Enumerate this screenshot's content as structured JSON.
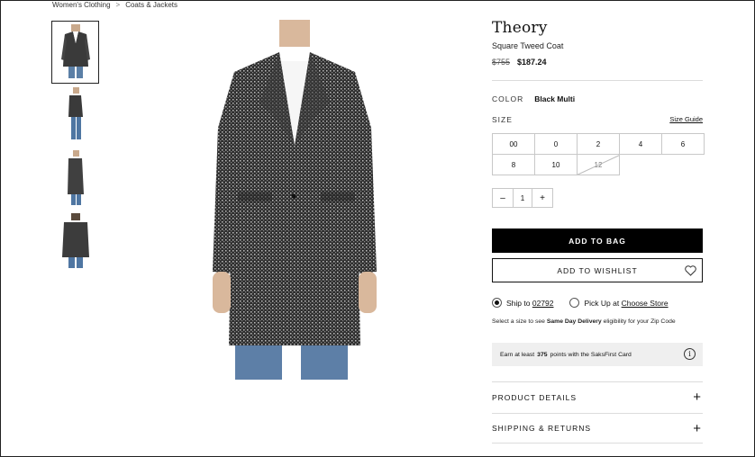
{
  "breadcrumb": {
    "items": [
      "Women's Clothing",
      "Coats & Jackets"
    ],
    "separator": ">"
  },
  "product": {
    "brand": "Theory",
    "name": "Square Tweed Coat",
    "price_original": "$755",
    "price_sale": "$187.24"
  },
  "color": {
    "label": "COLOR",
    "value": "Black Multi"
  },
  "size": {
    "label": "SIZE",
    "guide_label": "Size Guide",
    "options": [
      {
        "value": "00",
        "available": true
      },
      {
        "value": "0",
        "available": true
      },
      {
        "value": "2",
        "available": true
      },
      {
        "value": "4",
        "available": true
      },
      {
        "value": "6",
        "available": true
      },
      {
        "value": "8",
        "available": true
      },
      {
        "value": "10",
        "available": true
      },
      {
        "value": "12",
        "available": false
      }
    ]
  },
  "quantity": {
    "decrement": "–",
    "value": "1",
    "increment": "+"
  },
  "buttons": {
    "add_to_bag": "ADD TO BAG",
    "add_to_wishlist": "ADD TO WISHLIST"
  },
  "fulfillment": {
    "ship_prefix": "Ship to",
    "zip": "02792",
    "pickup_prefix": "Pick Up at",
    "store": "Choose Store",
    "selected": "ship"
  },
  "delivery_note": {
    "before": "Select a size to see",
    "bold": "Same Day Delivery",
    "after": "eligibility for your Zip Code"
  },
  "points": {
    "before": "Earn at least",
    "value": "375",
    "after": "points with the SaksFirst Card",
    "icon": "info-icon"
  },
  "accordions": [
    {
      "label": "PRODUCT DETAILS",
      "icon": "plus-icon"
    },
    {
      "label": "SHIPPING & RETURNS",
      "icon": "plus-icon"
    }
  ],
  "colors": {
    "button_dark": "#000000",
    "points_bg": "#efefef",
    "divider": "#dcdcdc"
  }
}
